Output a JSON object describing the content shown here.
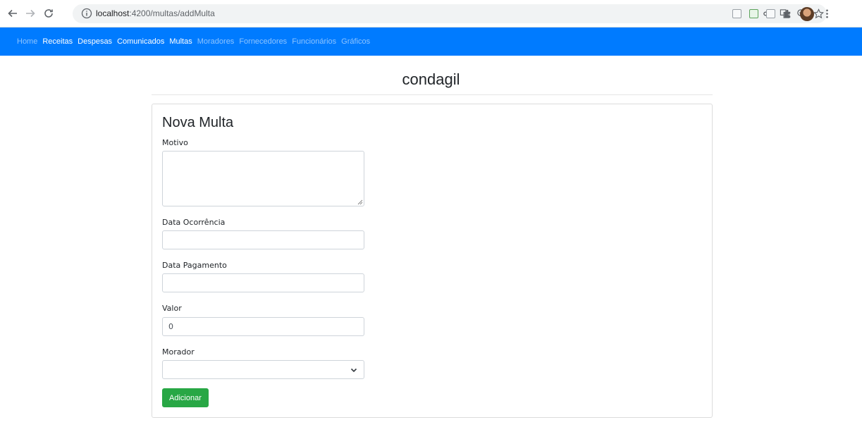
{
  "browser": {
    "url_host": "localhost",
    "url_path": ":4200/multas/addMulta"
  },
  "navbar": {
    "links": [
      {
        "label": "Home",
        "active": false
      },
      {
        "label": "Receitas",
        "active": true
      },
      {
        "label": "Despesas",
        "active": true
      },
      {
        "label": "Comunicados",
        "active": true
      },
      {
        "label": "Multas",
        "active": true
      },
      {
        "label": "Moradores",
        "active": false
      },
      {
        "label": "Fornecedores",
        "active": false
      },
      {
        "label": "Funcionários",
        "active": false
      },
      {
        "label": "Gráficos",
        "active": false
      }
    ]
  },
  "header": {
    "brand": "condagil"
  },
  "form": {
    "title": "Nova Multa",
    "motivo_label": "Motivo",
    "motivo_value": "",
    "data_ocorrencia_label": "Data Ocorrência",
    "data_ocorrencia_value": "",
    "data_pagamento_label": "Data Pagamento",
    "data_pagamento_value": "",
    "valor_label": "Valor",
    "valor_value": "0",
    "morador_label": "Morador",
    "morador_selected": "",
    "submit_label": "Adicionar"
  },
  "colors": {
    "navbar_bg": "#007bff",
    "submit_bg": "#28a745"
  }
}
